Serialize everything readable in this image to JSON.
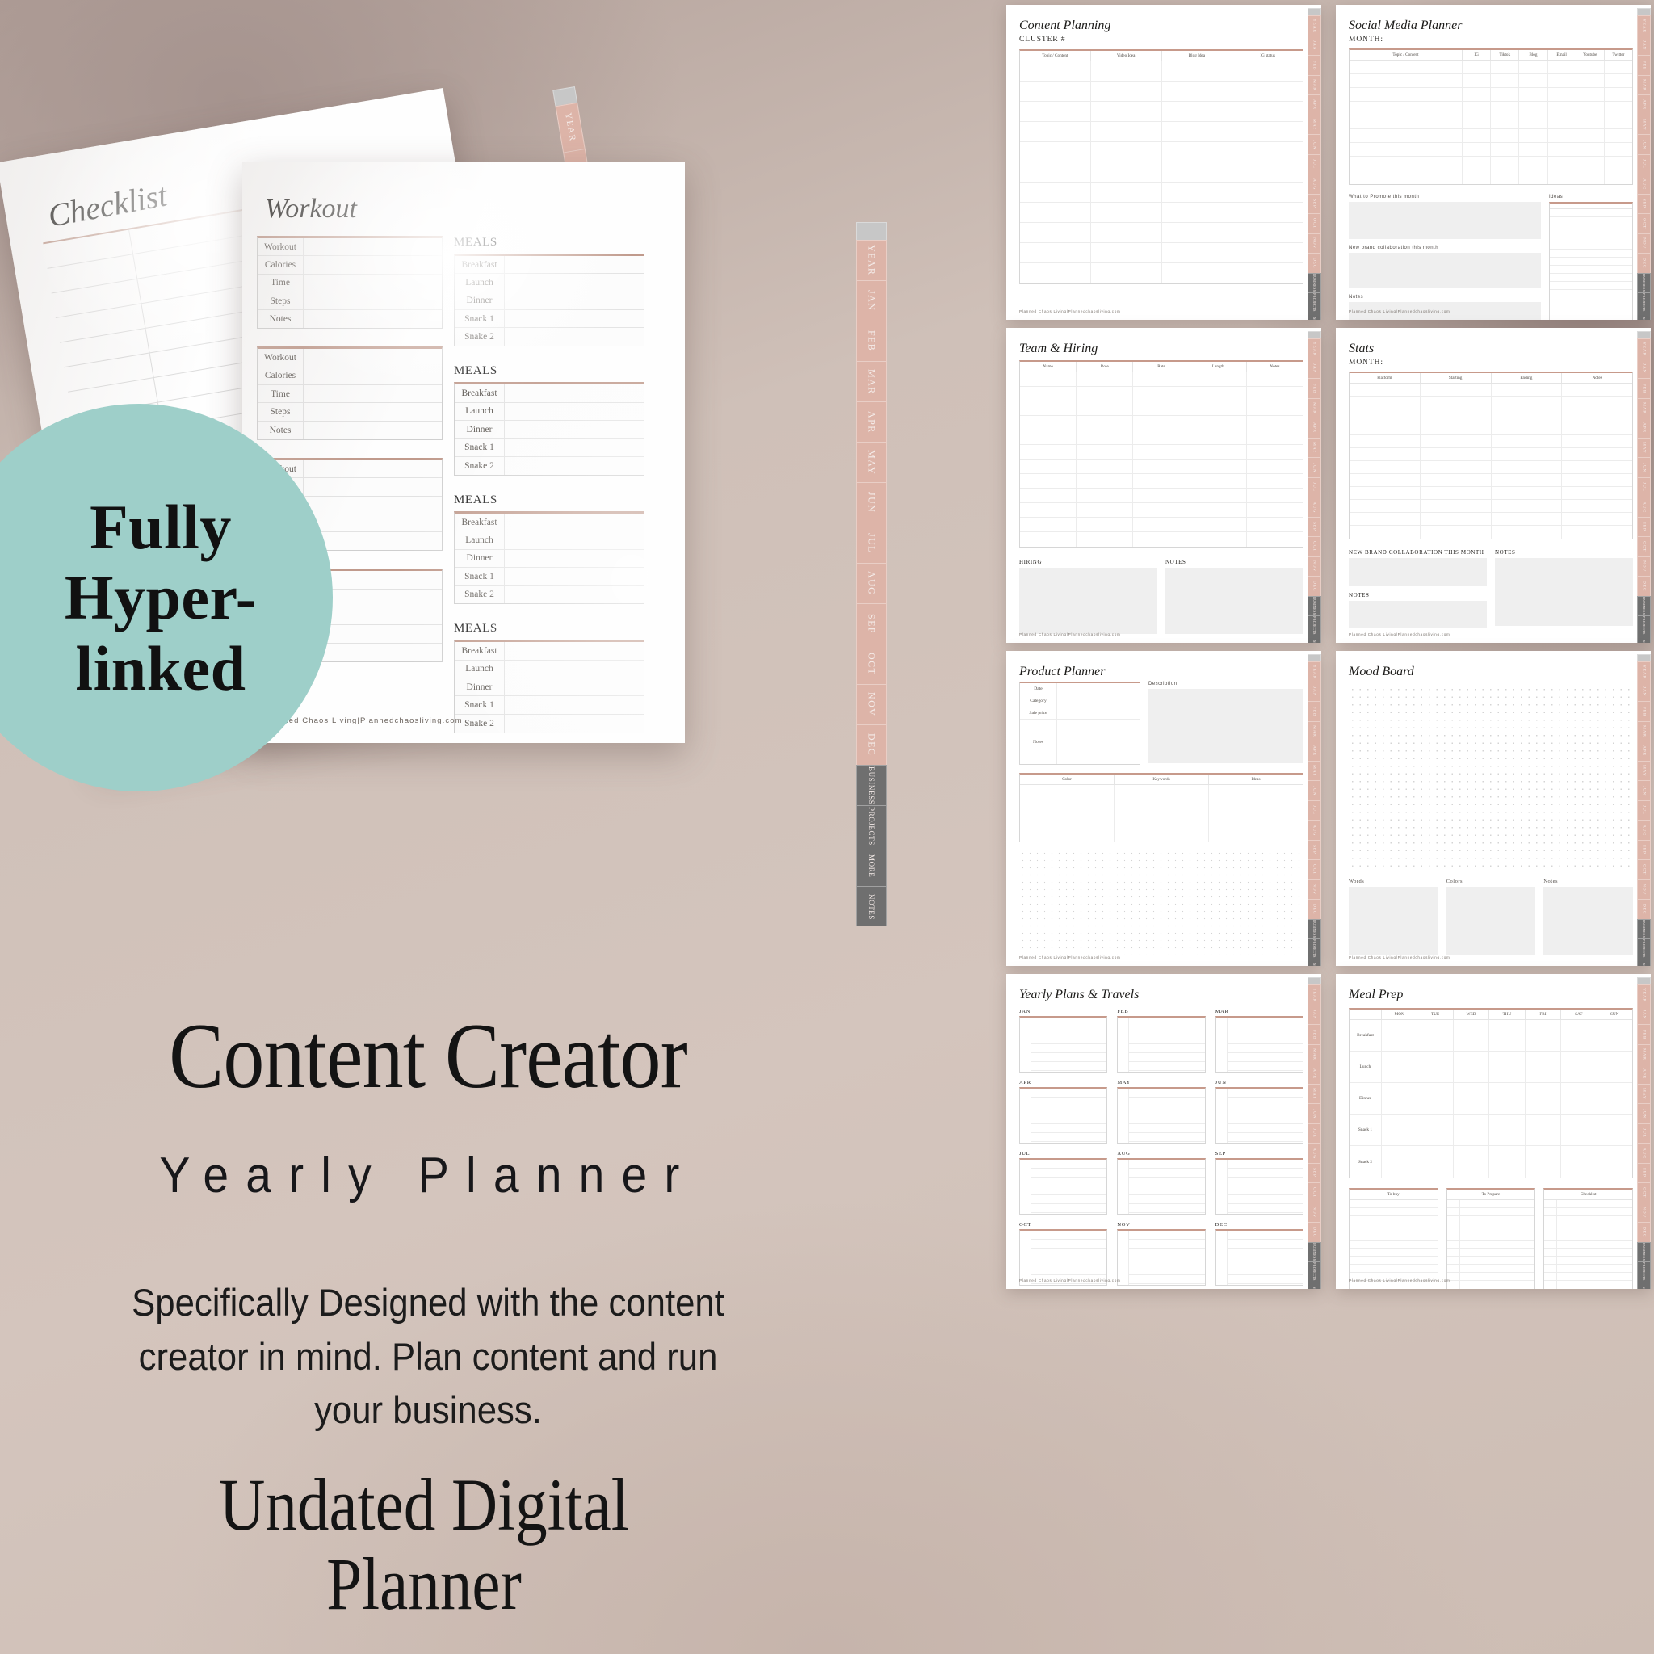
{
  "brand": {
    "footer": "Planned  Chaos  Living|Plannedchaosliving.com",
    "accent_rose": "#c79a8b",
    "tab_month_color": "#ddb4a8",
    "tab_dark_color": "#6f6f6f",
    "badge_color": "#9ecfc9",
    "background_color": "#cdbdb4"
  },
  "promo": {
    "badge_line1": "Fully",
    "badge_line2": "Hyper-",
    "badge_line3": "linked",
    "title_main": "Content Creator",
    "title_sub": "Yearly Planner",
    "description": "Specifically Designed with the content creator in mind. Plan content and run your business.",
    "title_undated_line1": "Undated Digital",
    "title_undated_line2": "Planner"
  },
  "tabs": {
    "months": [
      "YEAR",
      "JAN",
      "FEB",
      "MAR",
      "APR",
      "MAY",
      "JUN",
      "JUL",
      "AUG",
      "SEP",
      "OCT",
      "NOV",
      "DEC"
    ],
    "sections": [
      "BUSINESS",
      "PROJECTS",
      "MORE",
      "NOTES"
    ],
    "mini": [
      "YEAR",
      "JAN",
      "FEB"
    ]
  },
  "hero": {
    "checklist": {
      "title": "Checklist"
    },
    "workout": {
      "title": "Workout",
      "workout_rows": [
        "Workout",
        "Calories",
        "Time",
        "Steps",
        "Notes"
      ],
      "meals_heading": "MEALS",
      "meal_rows": [
        "Breakfast",
        "Launch",
        "Dinner",
        "Snack 1",
        "Snake 2"
      ],
      "block_count": 4
    }
  },
  "thumbnails": [
    {
      "id": "content-planning",
      "title": "Content Planning",
      "subtitle": "CLUSTER #",
      "columns": [
        "Topic / Content",
        "Video Idea",
        "Blog Idea",
        "IG status"
      ],
      "rows": 11
    },
    {
      "id": "social-media-planner",
      "title": "Social Media Planner",
      "subtitle": "MONTH:",
      "columns": [
        "Topic / Content",
        "IG",
        "Tiktok",
        "Blog",
        "Email",
        "Youtube",
        "Twitter"
      ],
      "rows": 9,
      "section_promote": "What to Promote this month",
      "section_ideas": "Ideas",
      "section_collab": "New brand collaboration this month",
      "section_notes": "Notes"
    },
    {
      "id": "team-and-hiring",
      "title": "Team & Hiring",
      "subtitle": "",
      "columns": [
        "Name",
        "Role",
        "Rate",
        "Length",
        "Notes"
      ],
      "rows": 12,
      "section_hiring": "HIRING",
      "section_notes": "NOTES"
    },
    {
      "id": "stats",
      "title": "Stats",
      "subtitle": "MONTH:",
      "columns": [
        "Platform",
        "Starting",
        "Ending",
        "Notes"
      ],
      "rows": 12,
      "section_collab": "NEW BRAND COLLABORATION THIS MONTH",
      "section_notes": "NOTES",
      "section_notes2": "NOTES"
    },
    {
      "id": "product-planner",
      "title": "Product Planner",
      "info_rows": [
        "Date",
        "Category",
        "Sale price",
        "Notes"
      ],
      "description_label": "Description",
      "columns": [
        "Color",
        "Keywords",
        "Ideas"
      ]
    },
    {
      "id": "mood-board",
      "title": "Mood Board",
      "boxes": [
        "Words",
        "Colors",
        "Notes"
      ]
    },
    {
      "id": "yearly-plans-travels",
      "title": "Yearly Plans & Travels",
      "months": [
        "JAN",
        "FEB",
        "MAR",
        "APR",
        "MAY",
        "JUN",
        "JUL",
        "AUG",
        "SEP",
        "OCT",
        "NOV",
        "DEC"
      ]
    },
    {
      "id": "meal-prep",
      "title": "Meal Prep",
      "days": [
        "MON",
        "TUE",
        "WED",
        "THU",
        "FRI",
        "SAT",
        "SUN"
      ],
      "meals": [
        "Breakfast",
        "Lunch",
        "Dinner",
        "Snack 1",
        "Snack 2"
      ],
      "lists": [
        "To buy",
        "To Prepare",
        "Checklist"
      ]
    }
  ]
}
